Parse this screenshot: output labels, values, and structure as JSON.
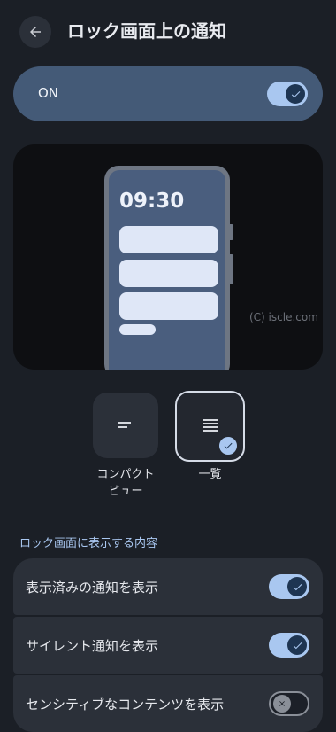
{
  "header": {
    "title": "ロック画面上の通知",
    "back_icon": "arrow-back-icon"
  },
  "master_toggle": {
    "label": "ON",
    "state": "on"
  },
  "preview": {
    "clock": "09:30",
    "watermark": "(C) iscle.com"
  },
  "style_options": [
    {
      "label": "コンパクト\nビュー",
      "selected": false
    },
    {
      "label": "一覧",
      "selected": true
    }
  ],
  "section": {
    "title": "ロック画面に表示する内容"
  },
  "settings": [
    {
      "label": "表示済みの通知を表示",
      "state": "on"
    },
    {
      "label": "サイレント通知を表示",
      "state": "on"
    },
    {
      "label": "センシティブなコンテンツを表示",
      "state": "off"
    }
  ],
  "colors": {
    "accent": "#a9c7f0",
    "background": "#1b1f26",
    "master_bg": "#445a77",
    "phone_screen": "#4a5e7e"
  }
}
